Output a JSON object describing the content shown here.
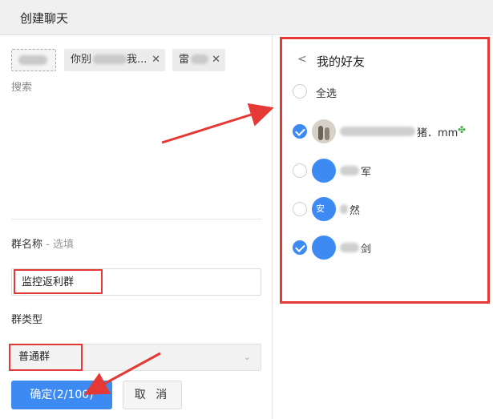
{
  "header": {
    "title": "创建聊天"
  },
  "selected": {
    "chips": [
      {
        "label": ""
      },
      {
        "label": "你别",
        "suffix": "我..."
      },
      {
        "label": "雷"
      }
    ],
    "search_label": "搜索"
  },
  "group_name": {
    "label": "群名称",
    "optional": " - 选填",
    "value": "监控返利群"
  },
  "group_type": {
    "label": "群类型",
    "value": "普通群"
  },
  "buttons": {
    "confirm": "确定(2/100)",
    "cancel": "取 消"
  },
  "friends": {
    "title": "我的好友",
    "select_all": "全选",
    "items": [
      {
        "name_suffix": "猪．mm",
        "avatar_text": "",
        "checked": true
      },
      {
        "name_suffix": "军",
        "avatar_text": "",
        "checked": false
      },
      {
        "name_suffix": "然",
        "avatar_text": "安",
        "checked": false
      },
      {
        "name_suffix": "剑",
        "avatar_text": "",
        "checked": true
      }
    ]
  },
  "colors": {
    "accent": "#3d8bf2",
    "highlight": "#e53935"
  }
}
